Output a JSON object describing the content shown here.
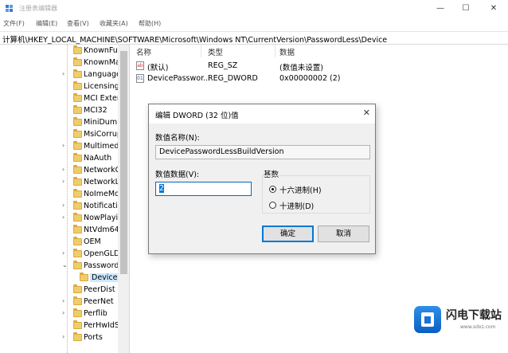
{
  "window": {
    "title": "注册表编辑器",
    "minimize": "—",
    "maximize": "☐",
    "close": "✕"
  },
  "menu": [
    {
      "label": "文件(F)"
    },
    {
      "label": "编辑(E)"
    },
    {
      "label": "查看(V)"
    },
    {
      "label": "收藏夹(A)"
    },
    {
      "label": "帮助(H)"
    }
  ],
  "address": {
    "path": "计算机\\HKEY_LOCAL_MACHINE\\SOFTWARE\\Microsoft\\Windows NT\\CurrentVersion\\PasswordLess\\Device"
  },
  "tree": {
    "items": [
      {
        "label": "KnownFun"
      },
      {
        "label": "KnownMa"
      },
      {
        "label": "LanguageI"
      },
      {
        "label": "LicensingD"
      },
      {
        "label": "MCI Exten"
      },
      {
        "label": "MCI32"
      },
      {
        "label": "MiniDump"
      },
      {
        "label": "MsiCorrup"
      },
      {
        "label": "Multimedi"
      },
      {
        "label": "NaAuth"
      },
      {
        "label": "NetworkC"
      },
      {
        "label": "NetworkLi"
      },
      {
        "label": "NoImeMo"
      },
      {
        "label": "Notification"
      },
      {
        "label": "NowPlayin"
      },
      {
        "label": "NtVdm64"
      },
      {
        "label": "OEM"
      },
      {
        "label": "OpenGLDr"
      },
      {
        "label": "PasswordL"
      },
      {
        "label": "Device"
      },
      {
        "label": "PeerDist"
      },
      {
        "label": "PeerNet"
      },
      {
        "label": "Perflib"
      },
      {
        "label": "PerHwIdSt"
      },
      {
        "label": "Ports"
      }
    ]
  },
  "list": {
    "headers": {
      "name": "名称",
      "type": "类型",
      "data": "数据"
    },
    "rows": [
      {
        "icon": "ab",
        "name": "(默认)",
        "type": "REG_SZ",
        "data": "(数值未设置)"
      },
      {
        "icon": "01",
        "name": "DevicePasswor...",
        "type": "REG_DWORD",
        "data": "0x00000002 (2)"
      }
    ]
  },
  "dialog": {
    "title": "编辑 DWORD (32 位)值",
    "close": "✕",
    "name_label": "数值名称(N):",
    "name_value": "DevicePasswordLessBuildVersion",
    "data_label": "数值数据(V):",
    "data_value": "2",
    "base_label": "基数",
    "hex_label": "十六进制(H)",
    "dec_label": "十进制(D)",
    "ok": "确定",
    "cancel": "取消"
  },
  "watermark": {
    "brand": "闪电下载站",
    "url": "www.sdxz.com"
  }
}
